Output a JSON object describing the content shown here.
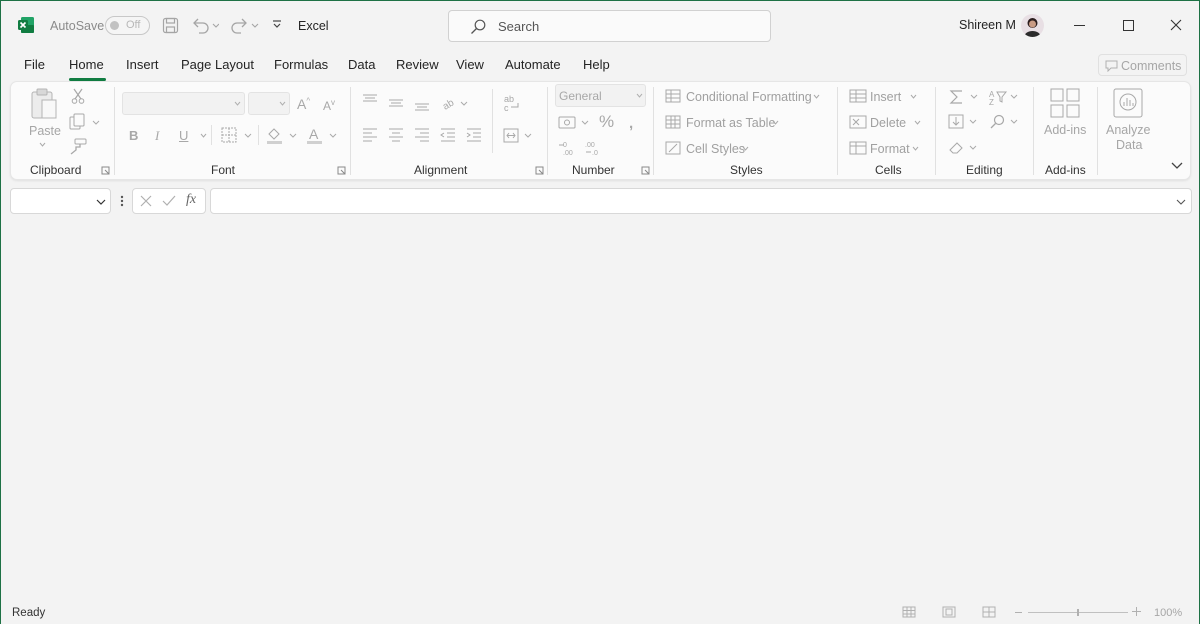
{
  "titlebar": {
    "autosave_label": "AutoSave",
    "autosave_state": "Off",
    "app_name": "Excel",
    "search_placeholder": "Search",
    "user_name": "Shireen M"
  },
  "tabs": [
    "File",
    "Home",
    "Insert",
    "Page Layout",
    "Formulas",
    "Data",
    "Review",
    "View",
    "Automate",
    "Help"
  ],
  "comments_label": "Comments",
  "ribbon": {
    "clipboard": {
      "paste": "Paste",
      "label": "Clipboard"
    },
    "font": {
      "label": "Font",
      "bold": "B",
      "italic": "I",
      "underline": "U"
    },
    "alignment": {
      "label": "Alignment"
    },
    "number": {
      "format": "General",
      "label": "Number",
      "percent": "%"
    },
    "styles": {
      "conditional": "Conditional Formatting",
      "format_table": "Format as Table",
      "cell_styles": "Cell Styles",
      "label": "Styles"
    },
    "cells": {
      "insert": "Insert",
      "delete": "Delete",
      "format": "Format",
      "label": "Cells"
    },
    "editing": {
      "label": "Editing"
    },
    "addins": {
      "button": "Add-ins",
      "label": "Add-ins"
    },
    "analyze": {
      "line1": "Analyze",
      "line2": "Data"
    }
  },
  "formula_bar": {
    "fx": "fx"
  },
  "status": {
    "ready": "Ready",
    "zoom": "100%"
  }
}
